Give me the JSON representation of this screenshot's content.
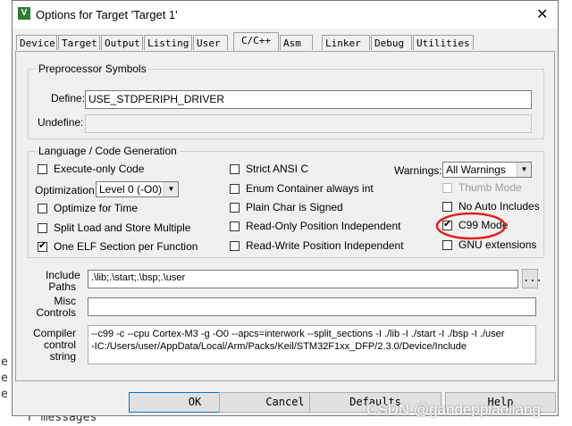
{
  "window": {
    "title": "Options for Target 'Target 1'",
    "close": "✕"
  },
  "tabs": [
    "Device",
    "Target",
    "Output",
    "Listing",
    "User",
    "C/C++",
    "Asm",
    "Linker",
    "Debug",
    "Utilities"
  ],
  "preprocessor": {
    "group_label": "Preprocessor Symbols",
    "define_label": "Define:",
    "define_value": "USE_STDPERIPH_DRIVER",
    "undefine_label": "Undefine:",
    "undefine_value": ""
  },
  "language": {
    "group_label": "Language / Code Generation",
    "execute_only": {
      "label": "Execute-only Code",
      "checked": false
    },
    "optimization_label": "Optimization:",
    "optimization_value": "Level 0 (-O0)",
    "optimize_time": {
      "label": "Optimize for Time",
      "checked": false
    },
    "split_load": {
      "label": "Split Load and Store Multiple",
      "checked": false
    },
    "one_elf": {
      "label": "One ELF Section per Function",
      "checked": true
    },
    "strict_ansi": {
      "label": "Strict ANSI C",
      "checked": false
    },
    "enum_container": {
      "label": "Enum Container always int",
      "checked": false
    },
    "plain_char": {
      "label": "Plain Char is Signed",
      "checked": false
    },
    "ropi": {
      "label": "Read-Only Position Independent",
      "checked": false
    },
    "rwpi": {
      "label": "Read-Write Position Independent",
      "checked": false
    },
    "warnings_label": "Warnings:",
    "warnings_value": "All Warnings",
    "thumb_mode": {
      "label": "Thumb Mode",
      "checked": false,
      "disabled": true
    },
    "no_auto_includes": {
      "label": "No Auto Includes",
      "checked": false
    },
    "c99_mode": {
      "label": "C99 Mode",
      "checked": true
    },
    "gnu_extensions": {
      "label": "GNU extensions",
      "checked": false
    }
  },
  "include": {
    "label_line1": "Include",
    "label_line2": "Paths",
    "value": ".\\lib;.\\start;.\\bsp;.\\user",
    "browse": "..."
  },
  "misc": {
    "label_line1": "Misc",
    "label_line2": "Controls",
    "value": ""
  },
  "compiler": {
    "label_line1": "Compiler",
    "label_line2": "control",
    "label_line3": "string",
    "value": "--c99 -c --cpu Cortex-M3 -g -O0 --apcs=interwork --split_sections -I ./lib -I ./start -I ./bsp -I ./user\n-IC:/Users/user/AppData/Local/Arm/Packs/Keil/STM32F1xx_DFP/2.3.0/Device/Include"
  },
  "buttons": {
    "ok": "OK",
    "cancel": "Cancel",
    "defaults": "Defaults",
    "help": "Help"
  },
  "background": {
    "bottom_text": "r messages",
    "watermark": "CSDN @gandeppiaoliang"
  },
  "colors": {
    "highlight_circle": "#e02020",
    "accent": "#0078d7"
  }
}
